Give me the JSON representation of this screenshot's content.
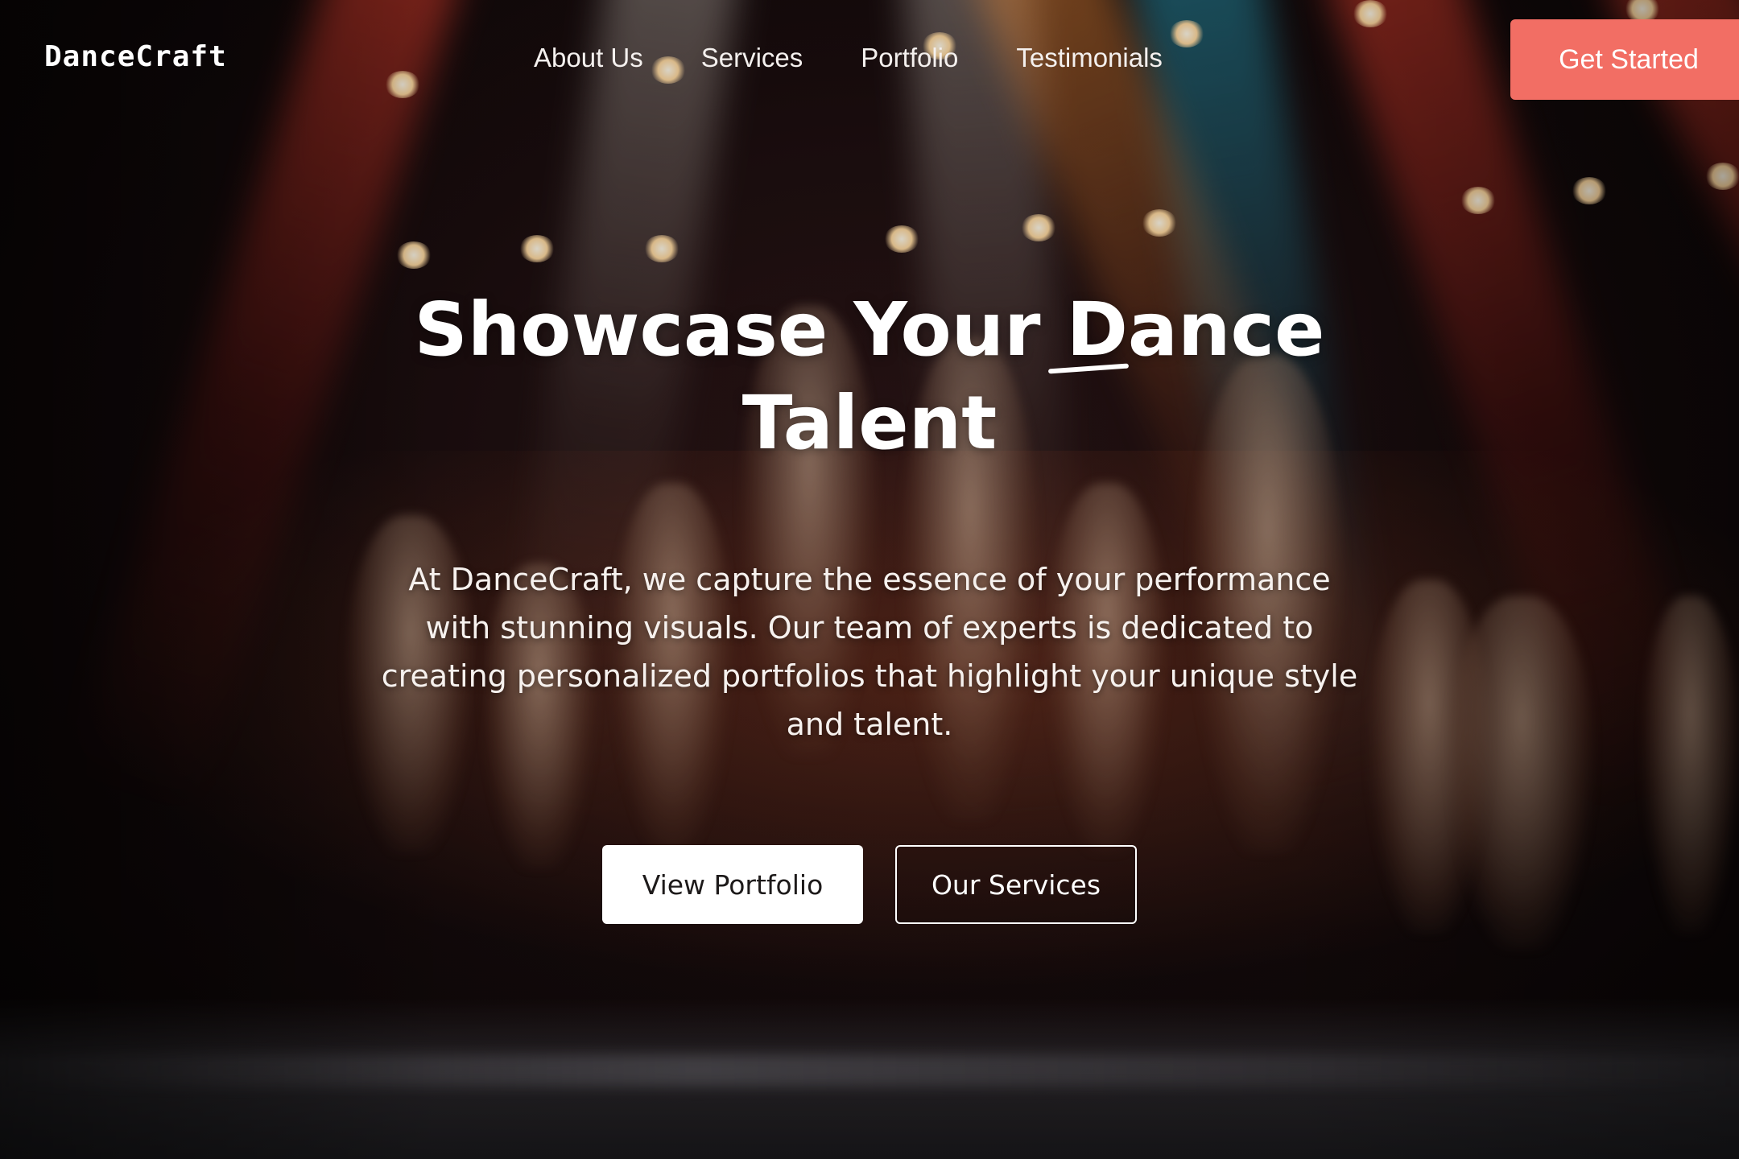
{
  "brand": {
    "logo_text": "DanceCraft",
    "accent_color": "#f26e64"
  },
  "nav": {
    "items": [
      {
        "label": "About Us"
      },
      {
        "label": "Services"
      },
      {
        "label": "Portfolio"
      },
      {
        "label": "Testimonials"
      }
    ],
    "cta_label": "Get Started"
  },
  "hero": {
    "title_line1": "Showcase Your Dance",
    "title_line2": "Talent",
    "description": "At DanceCraft, we capture the essence of your performance with stunning visuals. Our team of experts is dedicated to creating personalized portfolios that highlight your unique style and talent.",
    "primary_button": "View Portfolio",
    "secondary_button": "Our Services",
    "background_image": "dancers leaping on a stage under red, teal and amber spotlights"
  }
}
